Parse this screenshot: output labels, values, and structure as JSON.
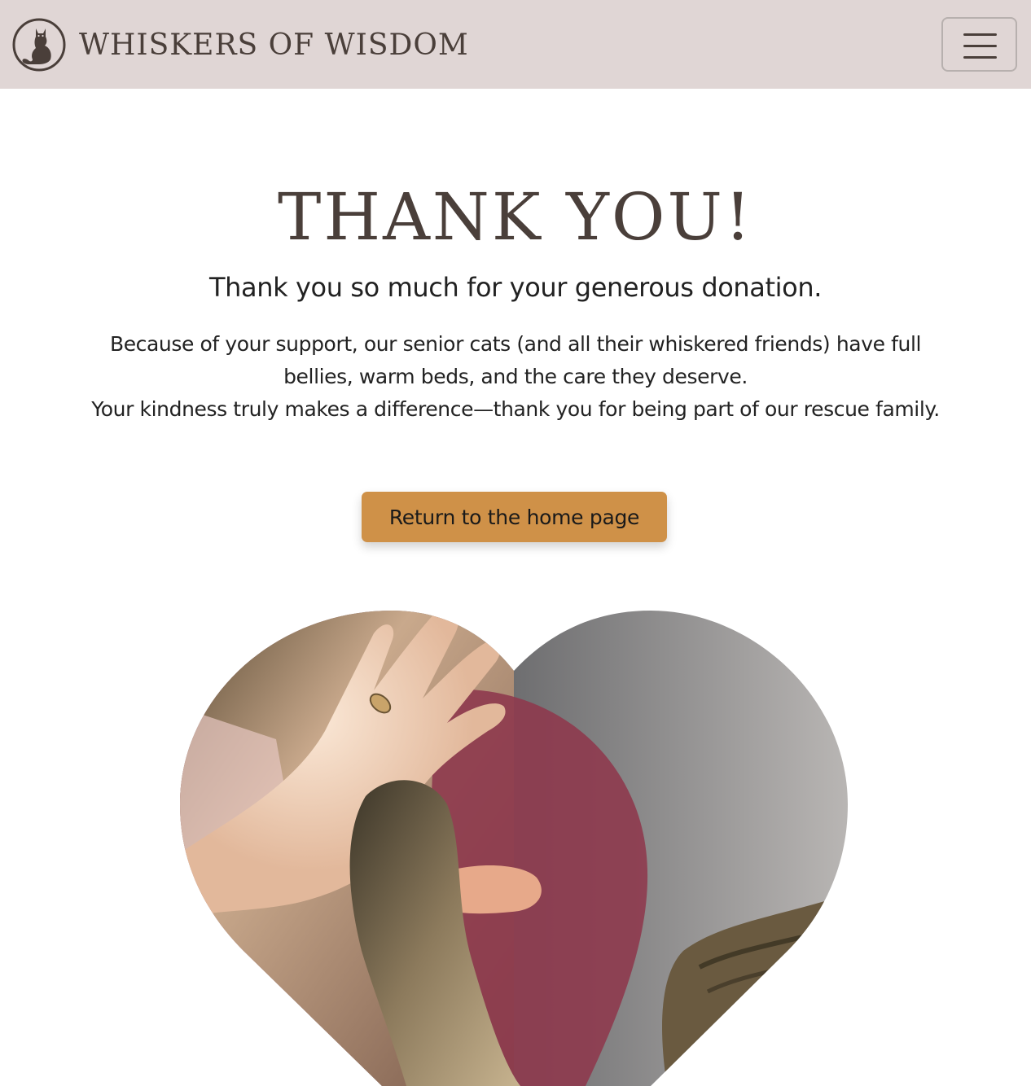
{
  "header": {
    "brand_name": "WHISKERS OF WISDOM",
    "logo_icon": "cat-silhouette-icon",
    "menu_icon": "hamburger-menu-icon"
  },
  "main": {
    "title": "THANK YOU!",
    "subtitle": "Thank you so much for your generous donation.",
    "paragraph_1": "Because of your support, our senior cats (and all their whiskered friends) have full bellies, warm beds, and the care they deserve.",
    "paragraph_2": "Your kindness truly makes a difference—thank you for being part of our rescue family.",
    "cta_label": "Return to the home page"
  },
  "image": {
    "shape": "heart",
    "subject": "hand-and-cat-paw-photo"
  },
  "colors": {
    "navbar_bg": "#e0d6d5",
    "brand_text": "#4a3f3a",
    "cta_bg": "#cf9148"
  }
}
